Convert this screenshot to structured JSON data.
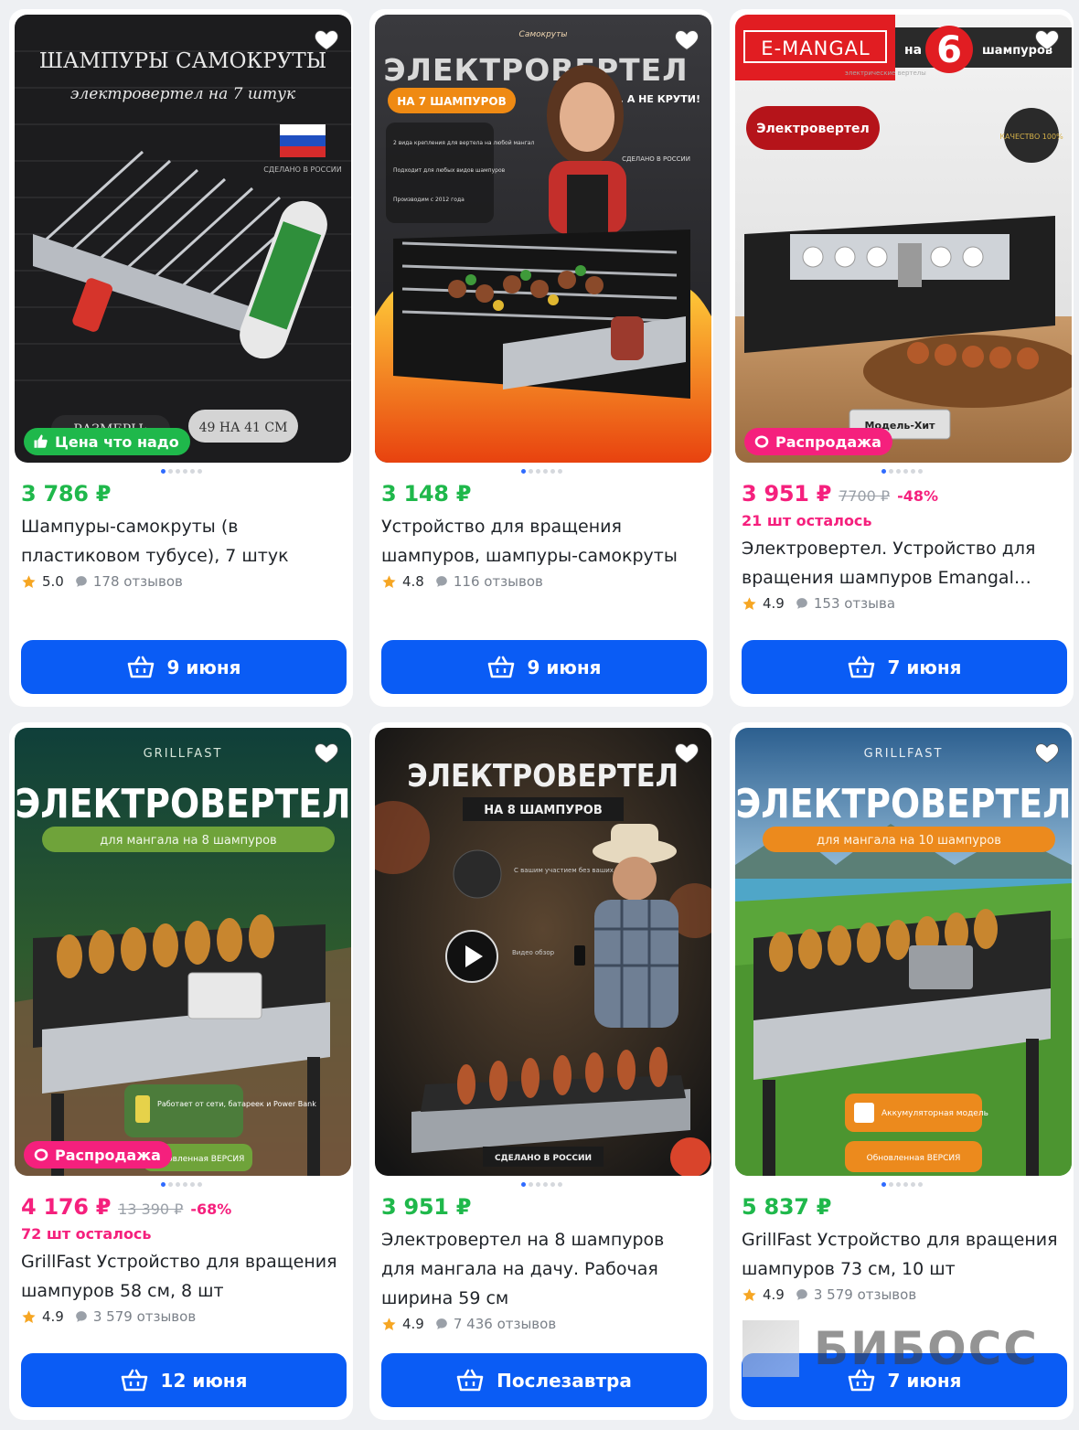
{
  "currency": "₽",
  "products": [
    {
      "image_headline": "ШАМПУРЫ САМОКРУТЫ",
      "image_subline": "электровертел на 7 штук",
      "image_extra": [
        "СДЕЛАНО В РОССИИ",
        "РАЗМЕРЫ:",
        "49 НА 41 СМ"
      ],
      "badge": "Цена что надо",
      "badge_color": "green",
      "price": "3 786 ₽",
      "old_price": "",
      "discount": "",
      "stock": "",
      "title": "Шампуры-самокруты (в пластиковом тубусе), 7 штук",
      "rating": "5.0",
      "reviews": "178 отзывов",
      "delivery": "9 июня"
    },
    {
      "image_headline": "ЭЛЕКТРОВЕРТЕЛ",
      "image_subline": "НА 7 ШАМПУРОВ",
      "image_extra": [
        "Самокруты",
        "ОТДЫХАЙ, А НЕ КРУТИ!",
        "2 вида крепления для вертела на любой мангал",
        "Подходит для любых видов шампуров",
        "Производим с 2012 года",
        "СДЕЛАНО В РОССИИ"
      ],
      "badge": "",
      "badge_color": "",
      "price": "3 148 ₽",
      "old_price": "",
      "discount": "",
      "stock": "",
      "title": "Устройство для вращения шампуров, шампуры-самокруты",
      "rating": "4.8",
      "reviews": "116 отзывов",
      "delivery": "9 июня"
    },
    {
      "image_headline": "E-MANGAL",
      "image_subline": "Электровертел",
      "image_extra": [
        "на",
        "6",
        "шампуров",
        "электрические вертелы",
        "КАЧЕСТВО 100%",
        "Модель-Хит"
      ],
      "badge": "Распродажа",
      "badge_color": "pink",
      "price": "3 951 ₽",
      "old_price": "7700 ₽",
      "discount": "-48%",
      "stock": "21 шт осталось",
      "title": "Электровертел. Устройство для вращения шампуров Emangal…",
      "rating": "4.9",
      "reviews": "153 отзыва",
      "delivery": "7 июня"
    },
    {
      "image_headline": "ЭЛЕКТРОВЕРТЕЛ",
      "image_subline": "для мангала на 8 шампуров",
      "image_extra": [
        "GRILLFAST",
        "Работает от сети, батареек и Power Bank",
        "Обновленная ВЕРСИЯ"
      ],
      "badge": "Распродажа",
      "badge_color": "pink",
      "price": "4 176 ₽",
      "old_price": "13 390 ₽",
      "discount": "-68%",
      "stock": "72 шт осталось",
      "title": "GrillFast Устройство для вращения шампуров 58 см, 8 шт",
      "rating": "4.9",
      "reviews": "3 579 отзывов",
      "delivery": "12 июня"
    },
    {
      "image_headline": "ЭЛЕКТРОВЕРТЕЛ",
      "image_subline": "НА 8 ШАМПУРОВ",
      "image_extra": [
        "С вашим участием без ваших усилий!",
        "Видео обзор",
        "СДЕЛАНО В РОССИИ"
      ],
      "badge": "",
      "badge_color": "",
      "price": "3 951 ₽",
      "old_price": "",
      "discount": "",
      "stock": "",
      "title": "Электровертел на 8 шампуров для мангала на дачу. Рабочая ширина 59 см",
      "rating": "4.9",
      "reviews": "7 436 отзывов",
      "delivery": "Послезавтра"
    },
    {
      "image_headline": "ЭЛЕКТРОВЕРТЕЛ",
      "image_subline": "для мангала на 10 шампуров",
      "image_extra": [
        "GRILLFAST",
        "Аккумуляторная модель",
        "Обновленная ВЕРСИЯ"
      ],
      "badge": "",
      "badge_color": "",
      "price": "5 837 ₽",
      "old_price": "",
      "discount": "",
      "stock": "",
      "title": "GrillFast Устройство для вращения шампуров 73 см, 10 шт",
      "rating": "4.9",
      "reviews": "3 579 отзывов",
      "delivery": "7 июня"
    }
  ],
  "watermark": "БИБОСС",
  "colors": {
    "accent_blue": "#0a5cf5",
    "price_green": "#1fb84b",
    "sale_pink": "#f5207d",
    "star": "#f6a623"
  }
}
